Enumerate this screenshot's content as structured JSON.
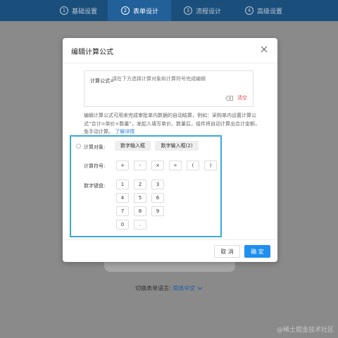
{
  "topnav": {
    "steps": [
      {
        "num": "1",
        "label": "基础设置"
      },
      {
        "num": "2",
        "label": "表单设计"
      },
      {
        "num": "3",
        "label": "流程设计"
      },
      {
        "num": "4",
        "label": "高级设置"
      }
    ],
    "active_step": "2"
  },
  "modal": {
    "title": "编辑计算公式",
    "formula_label": "计算公式=",
    "formula_placeholder": "请在下方选择计算对象和计算符号完成编辑",
    "clear_label": "清空",
    "description": "编辑计算公式可用来完成审批单内数据的自动结算，例如：采购单内设置计算公式“合计=单价×数量”，发起人填写单价、数量后，组件将自动计算出合计金额，免手动计算。",
    "help_link": "了解详情",
    "calc_object_label": "计算对象:",
    "calc_objects": [
      "数字输入框",
      "数字输入框(2)"
    ],
    "operator_label": "计算符号:",
    "operators": [
      "+",
      "-",
      "×",
      "÷",
      "(",
      ")"
    ],
    "keypad_label": "数字键盘:",
    "keypad": [
      "1",
      "2",
      "3",
      "4",
      "5",
      "6",
      "7",
      "8",
      "9",
      "0",
      "."
    ],
    "cancel_label": "取 消",
    "confirm_label": "确 定"
  },
  "footer": {
    "lang_label": "切换表单语言:",
    "lang_value": "简体中文"
  },
  "watermark": "@稀土掘金技术社区",
  "colors": {
    "nav_bg": "#1a4f7c",
    "nav_active": "#22609a",
    "primary": "#1f8ff0",
    "highlight_border": "#39a8e0",
    "danger": "#e0514b",
    "link": "#2f7de1"
  }
}
